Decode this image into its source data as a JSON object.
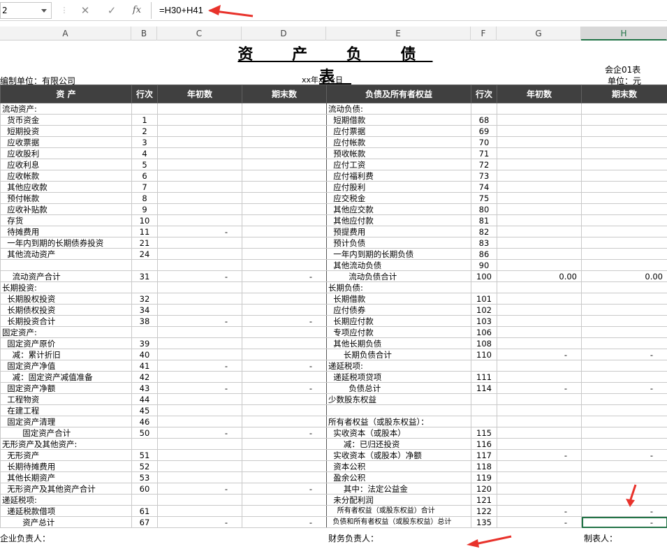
{
  "formula_bar": {
    "name_box": "2",
    "cancel_icon": "✕",
    "enter_icon": "✓",
    "fx_label": "fx",
    "formula": "=H30+H41"
  },
  "columns": [
    "A",
    "B",
    "C",
    "D",
    "E",
    "F",
    "G",
    "H"
  ],
  "sheet": {
    "title": "资  产  负  债  表",
    "company": "编制单位：有限公司",
    "date": "xx年x月x日",
    "form_code": "会企01表",
    "unit": "单位：元"
  },
  "headers": [
    "资      产",
    "行次",
    "年初数",
    "期末数",
    "负债及所有者权益",
    "行次",
    "年初数",
    "期末数"
  ],
  "rows": [
    [
      "流动资产:",
      "",
      "",
      "",
      "流动负债:",
      "",
      "",
      ""
    ],
    [
      "  货币资金",
      "1",
      "",
      "",
      "  短期借款",
      "68",
      "",
      ""
    ],
    [
      "  短期投资",
      "2",
      "",
      "",
      "  应付票据",
      "69",
      "",
      ""
    ],
    [
      "  应收票据",
      "3",
      "",
      "",
      "  应付帐款",
      "70",
      "",
      ""
    ],
    [
      "  应收股利",
      "4",
      "",
      "",
      "  预收帐款",
      "71",
      "",
      ""
    ],
    [
      "  应收利息",
      "5",
      "",
      "",
      "  应付工资",
      "72",
      "",
      ""
    ],
    [
      "  应收帐款",
      "6",
      "",
      "",
      "  应付福利费",
      "73",
      "",
      ""
    ],
    [
      "  其他应收款",
      "7",
      "",
      "",
      "  应付股利",
      "74",
      "",
      ""
    ],
    [
      "  预付帐款",
      "8",
      "",
      "",
      "  应交税金",
      "75",
      "",
      ""
    ],
    [
      "  应收补贴款",
      "9",
      "",
      "",
      "  其他应交款",
      "80",
      "",
      ""
    ],
    [
      "  存货",
      "10",
      "",
      "",
      "  其他应付款",
      "81",
      "",
      ""
    ],
    [
      "  待摊费用",
      "11",
      "-",
      "",
      "  预提费用",
      "82",
      "",
      ""
    ],
    [
      "  一年内到期的长期债券投资",
      "21",
      "",
      "",
      "  预计负债",
      "83",
      "",
      ""
    ],
    [
      "  其他流动资产",
      "24",
      "",
      "",
      "  一年内到期的长期负债",
      "86",
      "",
      ""
    ],
    [
      "",
      "",
      "",
      "",
      "  其他流动负债",
      "90",
      "",
      ""
    ],
    [
      "    流动资产合计",
      "31",
      "-",
      "-",
      "        流动负债合计",
      "100",
      "0.00",
      "0.00"
    ],
    [
      "长期投资:",
      "",
      "",
      "",
      "长期负债:",
      "",
      "",
      ""
    ],
    [
      "  长期股权投资",
      "32",
      "",
      "",
      "  长期借款",
      "101",
      "",
      ""
    ],
    [
      "  长期债权投资",
      "34",
      "",
      "",
      "  应付债券",
      "102",
      "",
      ""
    ],
    [
      "  长期投资合计",
      "38",
      "-",
      "-",
      "  长期应付款",
      "103",
      "",
      ""
    ],
    [
      "固定资产:",
      "",
      "",
      "",
      "  专项应付款",
      "106",
      "",
      ""
    ],
    [
      "  固定资产原价",
      "39",
      "",
      "",
      "  其他长期负债",
      "108",
      "",
      ""
    ],
    [
      "    减：累计折旧",
      "40",
      "",
      "",
      "      长期负债合计",
      "110",
      "-",
      "-"
    ],
    [
      "  固定资产净值",
      "41",
      "-",
      "-",
      "递延税项:",
      "",
      "",
      ""
    ],
    [
      "    减：固定资产减值准备",
      "42",
      "",
      "",
      "  递延税项贷项",
      "111",
      "",
      ""
    ],
    [
      "  固定资产净额",
      "43",
      "-",
      "-",
      "        负债总计",
      "114",
      "-",
      "-"
    ],
    [
      "  工程物资",
      "44",
      "",
      "",
      "少数股东权益",
      "",
      "",
      ""
    ],
    [
      "  在建工程",
      "45",
      "",
      "",
      "",
      "",
      "",
      ""
    ],
    [
      "  固定资产清理",
      "46",
      "",
      "",
      "所有者权益（或股东权益）：",
      "",
      "",
      ""
    ],
    [
      "        固定资产合计",
      "50",
      "-",
      "-",
      "  实收资本（或股本）",
      "115",
      "",
      ""
    ],
    [
      "无形资产及其他资产:",
      "",
      "",
      "",
      "      减：已归还投资",
      "116",
      "",
      ""
    ],
    [
      "  无形资产",
      "51",
      "",
      "",
      "  实收资本（或股本）净额",
      "117",
      "-",
      "-"
    ],
    [
      "  长期待摊费用",
      "52",
      "",
      "",
      "  资本公积",
      "118",
      "",
      ""
    ],
    [
      "  其他长期资产",
      "53",
      "",
      "",
      "  盈余公积",
      "119",
      "",
      ""
    ],
    [
      "  无形资产及其他资产合计",
      "60",
      "-",
      "-",
      "      其中：法定公益金",
      "120",
      "",
      ""
    ],
    [
      "递延税项:",
      "",
      "",
      "",
      "  未分配利润",
      "121",
      "",
      ""
    ],
    [
      "  递延税款借项",
      "61",
      "",
      "",
      "    所有者权益（或股东权益）合计",
      "122",
      "-",
      "-"
    ],
    [
      "        资产总计",
      "67",
      "-",
      "-",
      "  负债和所有者权益（或股东权益）总计",
      "135",
      "-",
      "-"
    ]
  ],
  "footer": {
    "legal_rep": "企业负责人：",
    "finance_head": "财务负责人：",
    "preparer": "制表人："
  },
  "colors": {
    "header_bg": "#404040",
    "selection": "#217346",
    "annotation_arrow": "#e8322b"
  }
}
